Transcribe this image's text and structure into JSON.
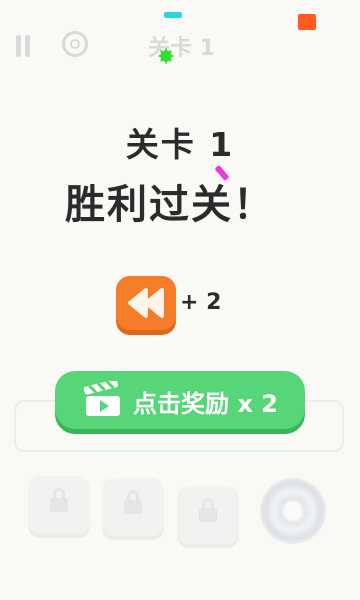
{
  "hud": {
    "level_label": "关卡 1"
  },
  "result": {
    "level_title": "关卡 1",
    "win_text": "胜利过关！"
  },
  "reward": {
    "icon": "rewind-icon",
    "count_text": "+ 2"
  },
  "claim_button": {
    "icon": "video-clapper-icon",
    "label": "点击奖励 x 2"
  },
  "colors": {
    "background": "#fbf9f6",
    "title_text": "#2b2b2b",
    "reward_icon": "#f57c29",
    "claim_button": "#57d679"
  }
}
